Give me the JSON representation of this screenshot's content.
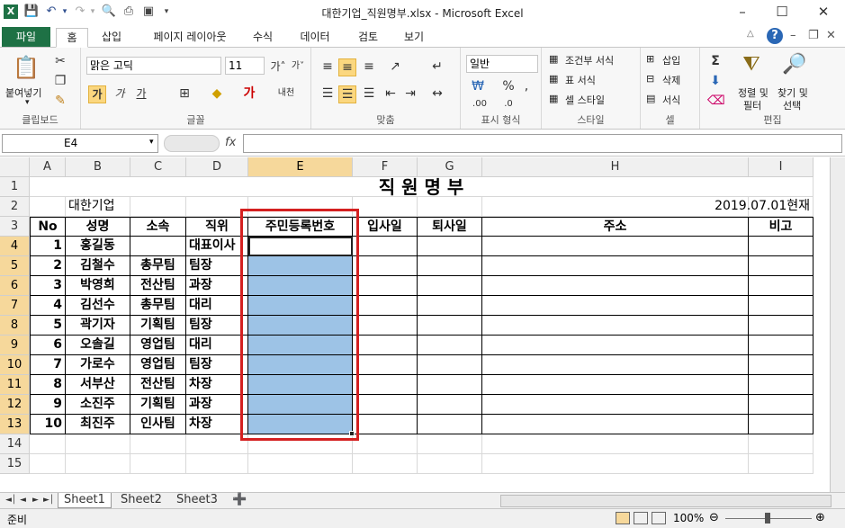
{
  "window": {
    "title": "대한기업_직원명부.xlsx  -  Microsoft Excel",
    "app_icon": "X"
  },
  "ribbon_tabs": {
    "file": "파일",
    "home": "홈",
    "insert": "삽입",
    "layout": "페이지 레이아웃",
    "formulas": "수식",
    "data": "데이터",
    "review": "검토",
    "view": "보기"
  },
  "ribbon": {
    "paste": "붙여넣기",
    "clipboard": "클립보드",
    "font_name": "맑은 고딕",
    "font_size": "11",
    "font_group": "글꼴",
    "align_group": "맞춤",
    "number_format": "일반",
    "number_group": "표시 형식",
    "cond_format": "조건부 서식",
    "table_format": "표 서식",
    "cell_style": "셀 스타일",
    "style_group": "스타일",
    "insert": "삽입",
    "delete": "삭제",
    "format": "서식",
    "cells_group": "셀",
    "sort_filter_1": "정렬 및",
    "sort_filter_2": "필터",
    "find_select_1": "찾기 및",
    "find_select_2": "선택",
    "edit_group": "편집",
    "bold": "가",
    "italic": "가",
    "underline": "가",
    "percent": "%"
  },
  "formula_bar": {
    "name_box": "E4",
    "fx": "fx",
    "value": ""
  },
  "grid": {
    "col_headers": [
      "A",
      "B",
      "C",
      "D",
      "E",
      "F",
      "G",
      "H",
      "I"
    ],
    "row_headers": [
      "1",
      "2",
      "3",
      "4",
      "5",
      "6",
      "7",
      "8",
      "9",
      "10",
      "11",
      "12",
      "13",
      "14",
      "15"
    ],
    "title": "직  원  명  부",
    "company": "대한기업",
    "date_note": "2019.07.01현재",
    "headers": [
      "No",
      "성명",
      "소속",
      "직위",
      "주민등록번호",
      "입사일",
      "퇴사일",
      "주소",
      "비고"
    ],
    "rows": [
      {
        "no": "1",
        "name": "홍길동",
        "dept": "",
        "pos": "대표이사"
      },
      {
        "no": "2",
        "name": "김철수",
        "dept": "총무팀",
        "pos": "팀장"
      },
      {
        "no": "3",
        "name": "박영희",
        "dept": "전산팀",
        "pos": "과장"
      },
      {
        "no": "4",
        "name": "김선수",
        "dept": "총무팀",
        "pos": "대리"
      },
      {
        "no": "5",
        "name": "곽기자",
        "dept": "기획팀",
        "pos": "팀장"
      },
      {
        "no": "6",
        "name": "오솔길",
        "dept": "영업팀",
        "pos": "대리"
      },
      {
        "no": "7",
        "name": "가로수",
        "dept": "영업팀",
        "pos": "팀장"
      },
      {
        "no": "8",
        "name": "서부산",
        "dept": "전산팀",
        "pos": "차장"
      },
      {
        "no": "9",
        "name": "소진주",
        "dept": "기획팀",
        "pos": "과장"
      },
      {
        "no": "10",
        "name": "최진주",
        "dept": "인사팀",
        "pos": "차장"
      }
    ]
  },
  "sheets": {
    "tabs": [
      "Sheet1",
      "Sheet2",
      "Sheet3"
    ],
    "active": "Sheet1"
  },
  "status": {
    "ready": "준비",
    "zoom": "100%"
  }
}
